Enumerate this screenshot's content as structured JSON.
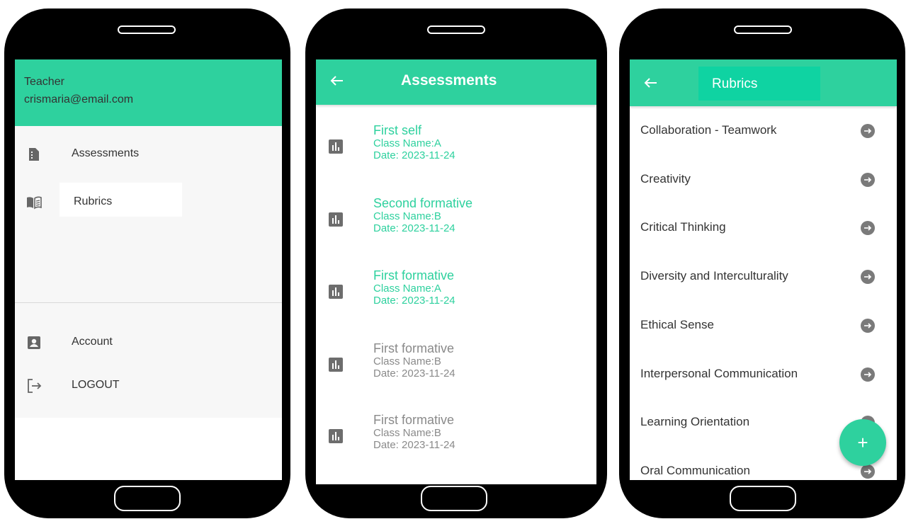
{
  "drawer_screen": {
    "header": {
      "role": "Teacher",
      "email": "crismaria@email.com"
    },
    "menu": [
      {
        "label": "Assessments",
        "icon": "document-icon"
      },
      {
        "label": "Rubrics",
        "icon": "book-icon",
        "selected": true
      },
      {
        "label": "Account",
        "icon": "account-box-icon"
      },
      {
        "label": "LOGOUT",
        "icon": "logout-icon"
      }
    ]
  },
  "assessments_screen": {
    "title": "Assessments",
    "items": [
      {
        "name": "First self",
        "class": "Class Name:A",
        "date": "Date: 2023-11-24",
        "color": "#2ed19e"
      },
      {
        "name": "Second formative",
        "class": "Class Name:B",
        "date": "Date: 2023-11-24",
        "color": "#2ed19e"
      },
      {
        "name": "First formative",
        "class": "Class Name:A",
        "date": "Date: 2023-11-24",
        "color": "#2ed19e"
      },
      {
        "name": "First formative",
        "class": "Class Name:B",
        "date": "Date: 2023-11-24",
        "color": "#8a8a8a"
      },
      {
        "name": "First formative",
        "class": "Class Name:B",
        "date": "Date: 2023-11-24",
        "color": "#8a8a8a"
      }
    ]
  },
  "rubrics_screen": {
    "title": "Rubrics",
    "items": [
      "Collaboration - Teamwork",
      "Creativity",
      "Critical Thinking",
      "Diversity and Interculturality",
      "Ethical Sense",
      "Interpersonal Communication",
      "Learning Orientation",
      "Oral Communication"
    ],
    "fab_label": "+"
  },
  "colors": {
    "accent": "#2ed19e",
    "title_box": "#0fd3a2",
    "muted": "#8a8a8a"
  }
}
